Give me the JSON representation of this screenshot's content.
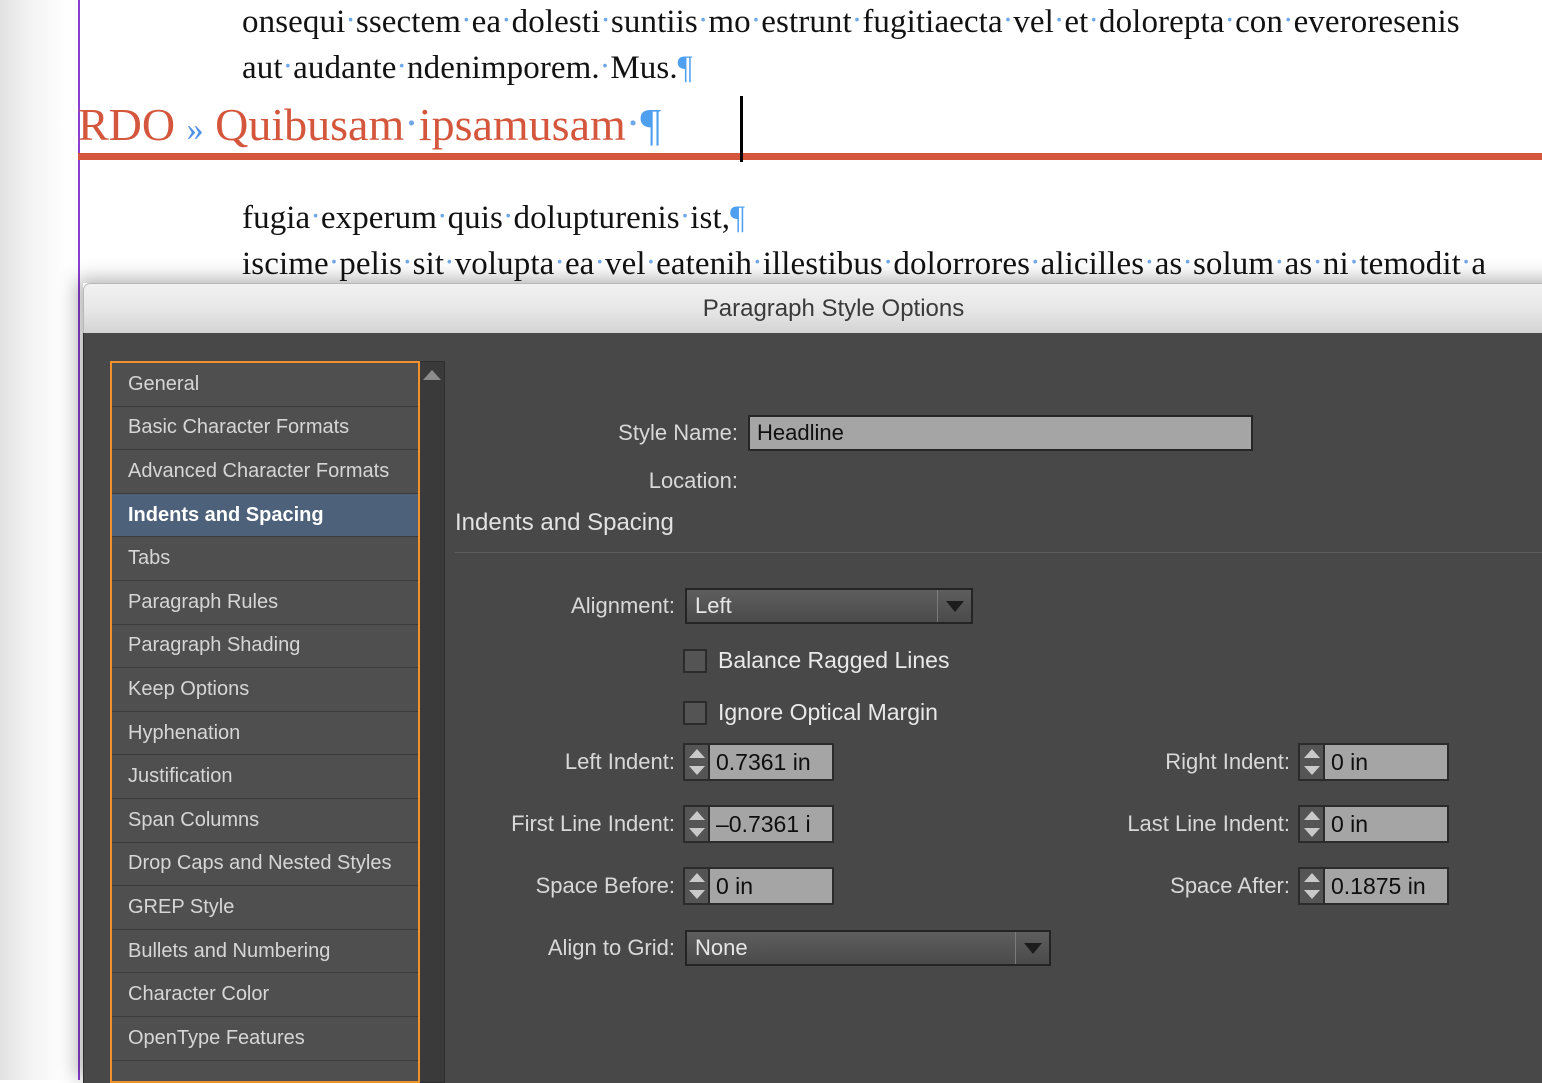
{
  "document": {
    "lines": [
      "onsequi ssectem ea dolesti suntiis mo estrunt fugitiaecta vel et dolorepta con everoresenis",
      "aut audante ndenimporem. Mus.",
      "fugia experum quis dolupturenis ist,",
      "iscime pelis sit volupta ea vel eatenih illestibus dolorrores alicilles as solum as ni temodit a"
    ],
    "headline": {
      "prefix": "RDO",
      "tab_marker": "»",
      "rest": "Quibusam ipsamusam",
      "color": "#d4563c"
    },
    "guide_color": "#8a3fd1",
    "pilcrow_glyph": "¶",
    "space_dot_glyph": "·"
  },
  "dialog": {
    "title": "Paragraph Style Options",
    "accent_color": "#f0922b",
    "selection_color": "#4e617a",
    "background": "#484848",
    "categories": [
      {
        "label": "General",
        "selected": false
      },
      {
        "label": "Basic Character Formats",
        "selected": false
      },
      {
        "label": "Advanced Character Formats",
        "selected": false
      },
      {
        "label": "Indents and Spacing",
        "selected": true
      },
      {
        "label": "Tabs",
        "selected": false
      },
      {
        "label": "Paragraph Rules",
        "selected": false
      },
      {
        "label": "Paragraph Shading",
        "selected": false
      },
      {
        "label": "Keep Options",
        "selected": false
      },
      {
        "label": "Hyphenation",
        "selected": false
      },
      {
        "label": "Justification",
        "selected": false
      },
      {
        "label": "Span Columns",
        "selected": false
      },
      {
        "label": "Drop Caps and Nested Styles",
        "selected": false
      },
      {
        "label": "GREP Style",
        "selected": false
      },
      {
        "label": "Bullets and Numbering",
        "selected": false
      },
      {
        "label": "Character Color",
        "selected": false
      },
      {
        "label": "OpenType Features",
        "selected": false
      }
    ],
    "style_name": {
      "label": "Style Name:",
      "value": "Headline"
    },
    "location": {
      "label": "Location:",
      "value": ""
    },
    "section_heading": "Indents and Spacing",
    "alignment": {
      "label": "Alignment:",
      "value": "Left"
    },
    "balance_ragged_lines": {
      "label": "Balance Ragged Lines",
      "checked": false
    },
    "ignore_optical_margin": {
      "label": "Ignore Optical Margin",
      "checked": false
    },
    "left_indent": {
      "label": "Left Indent:",
      "value": "0.7361 in"
    },
    "first_line_indent": {
      "label": "First Line Indent:",
      "value": "–0.7361 i"
    },
    "space_before": {
      "label": "Space Before:",
      "value": "0 in"
    },
    "right_indent": {
      "label": "Right Indent:",
      "value": "0 in"
    },
    "last_line_indent": {
      "label": "Last Line Indent:",
      "value": "0 in"
    },
    "space_after": {
      "label": "Space After:",
      "value": "0.1875 in"
    },
    "align_to_grid": {
      "label": "Align to Grid:",
      "value": "None"
    }
  }
}
